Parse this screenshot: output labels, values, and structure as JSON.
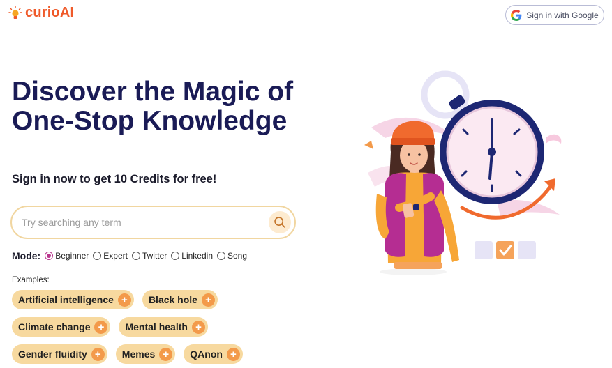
{
  "header": {
    "logo_text": "curioAI",
    "logo_icon": "lightbulb-icon",
    "signin_label": "Sign in with Google",
    "signin_icon": "google-g-icon"
  },
  "hero": {
    "title": "Discover the Magic of One-Stop Knowledge",
    "subtitle": "Sign in now to get 10 Credits for free!"
  },
  "search": {
    "placeholder": "Try searching any term",
    "value": "",
    "button_icon": "search-icon"
  },
  "mode": {
    "label": "Mode:",
    "selected": "Beginner",
    "options": [
      "Beginner",
      "Expert",
      "Twitter",
      "Linkedin",
      "Song"
    ]
  },
  "examples": {
    "label": "Examples:",
    "rows": [
      [
        "Artificial intelligence",
        "Black hole"
      ],
      [
        "Climate change",
        "Mental health"
      ],
      [
        "Gender fluidity",
        "Memes",
        "QAnon"
      ]
    ]
  },
  "colors": {
    "brand": "#ef5a2a",
    "title": "#1a1b56",
    "chip_bg": "#f7d99f",
    "chip_plus": "#f39a4a",
    "radio_checked": "#b8338c",
    "search_border": "#f1d6a0"
  }
}
